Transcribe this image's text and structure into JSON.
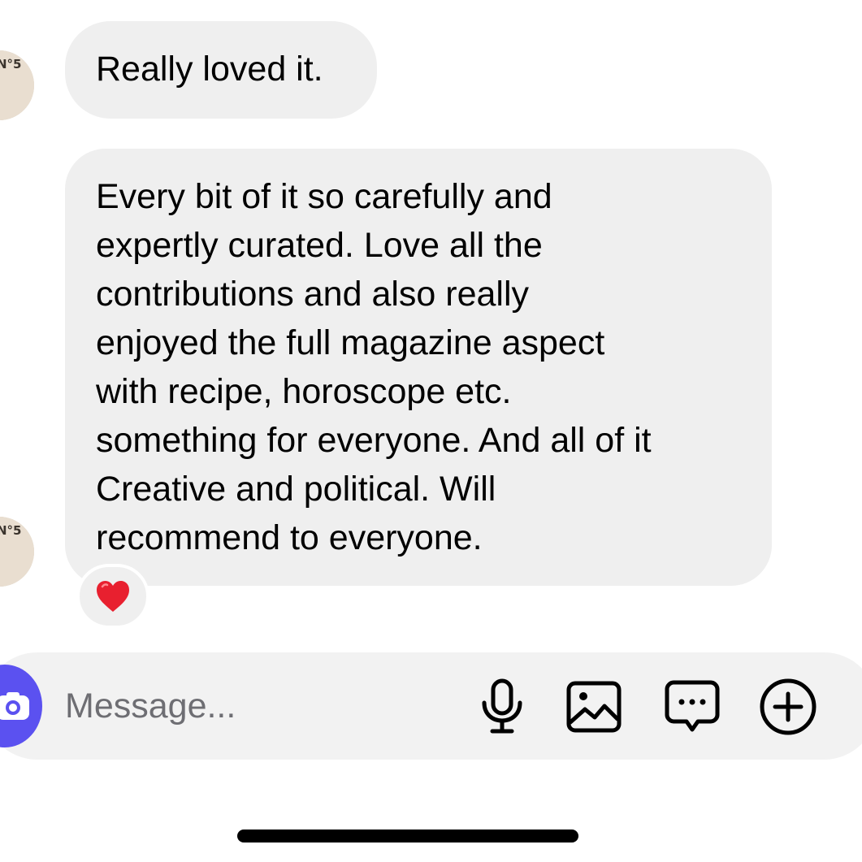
{
  "messages": [
    {
      "text": "Really loved it.",
      "avatar_icon": "contact-avatar"
    },
    {
      "lines": [
        "Every bit of it so carefully and",
        "expertly curated. Love all the",
        "contributions and also really",
        "enjoyed the full magazine aspect",
        "with recipe, horoscope etc.",
        "something for everyone. And all of it",
        "Creative and political. Will",
        "recommend to everyone."
      ],
      "avatar_icon": "contact-avatar",
      "reaction": "❤️"
    }
  ],
  "composer": {
    "placeholder": "Message...",
    "icons": [
      "camera-icon",
      "microphone-icon",
      "gallery-icon",
      "sticker-icon",
      "plus-icon"
    ],
    "camera_color": "#5b51f0"
  },
  "colors": {
    "bubble": "#efefef",
    "composer": "#f2f2f2",
    "heart": "#e8202f"
  }
}
